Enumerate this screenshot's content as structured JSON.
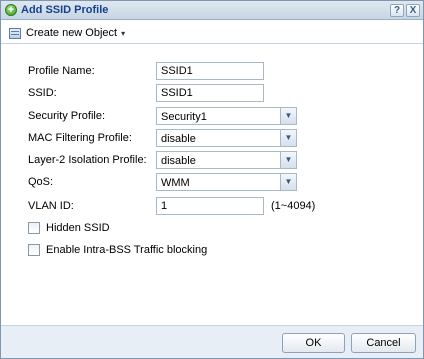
{
  "window": {
    "title": "Add SSID Profile",
    "help_label": "?",
    "close_label": "X"
  },
  "toolbar": {
    "create_label": "Create new Object",
    "caret": "▾"
  },
  "form": {
    "profile_name": {
      "label": "Profile Name:",
      "value": "SSID1"
    },
    "ssid": {
      "label": "SSID:",
      "value": "SSID1"
    },
    "security_profile": {
      "label": "Security Profile:",
      "value": "Security1"
    },
    "mac_filtering_profile": {
      "label": "MAC Filtering Profile:",
      "value": "disable"
    },
    "layer2_isolation_profile": {
      "label": "Layer-2 Isolation Profile:",
      "value": "disable"
    },
    "qos": {
      "label": "QoS:",
      "value": "WMM"
    },
    "vlan_id": {
      "label": "VLAN ID:",
      "value": "1",
      "hint": "(1~4094)"
    },
    "hidden_ssid": {
      "label": "Hidden SSID",
      "checked": false
    },
    "intra_bss_blocking": {
      "label": "Enable Intra-BSS Traffic blocking",
      "checked": false
    }
  },
  "footer": {
    "ok_label": "OK",
    "cancel_label": "Cancel"
  },
  "icons": {
    "add": "add-circle-icon",
    "object": "object-icon",
    "dropdown": "chevron-down-icon"
  }
}
